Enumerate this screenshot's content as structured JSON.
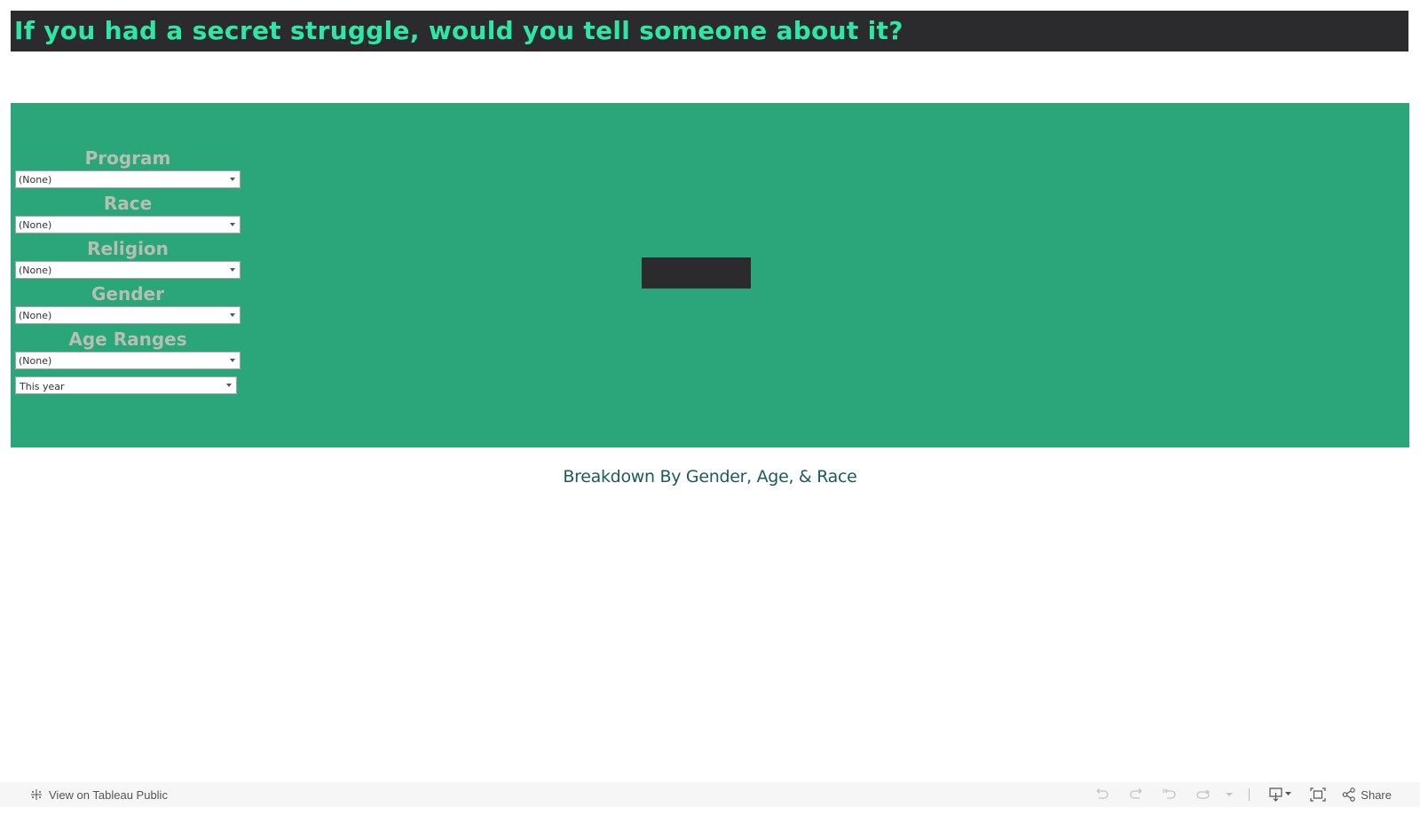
{
  "header": {
    "title": "If you had a secret struggle, would you tell someone about it?"
  },
  "filters": [
    {
      "label": "Program",
      "value": "(None)"
    },
    {
      "label": "Race",
      "value": "(None)"
    },
    {
      "label": "Religion",
      "value": "(None)"
    },
    {
      "label": "Gender",
      "value": "(None)"
    },
    {
      "label": "Age Ranges",
      "value": "(None)"
    }
  ],
  "date_filter": {
    "value": "This year"
  },
  "subtitle": "Breakdown By Gender, Age, & Race",
  "footer": {
    "view_link": "View on Tableau Public",
    "share_label": "Share",
    "icons": [
      "tableau-logo-icon",
      "undo-icon",
      "redo-icon",
      "revert-icon",
      "refresh-icon",
      "pause-dropdown-icon",
      "download-icon",
      "fullscreen-icon",
      "share-icon"
    ]
  },
  "colors": {
    "header_bg": "#2b2b2d",
    "title_text": "#2ee6a6",
    "panel_bg": "#2aa67a",
    "filter_label": "#b6bfb3",
    "subtitle_text": "#1c5a5e"
  }
}
